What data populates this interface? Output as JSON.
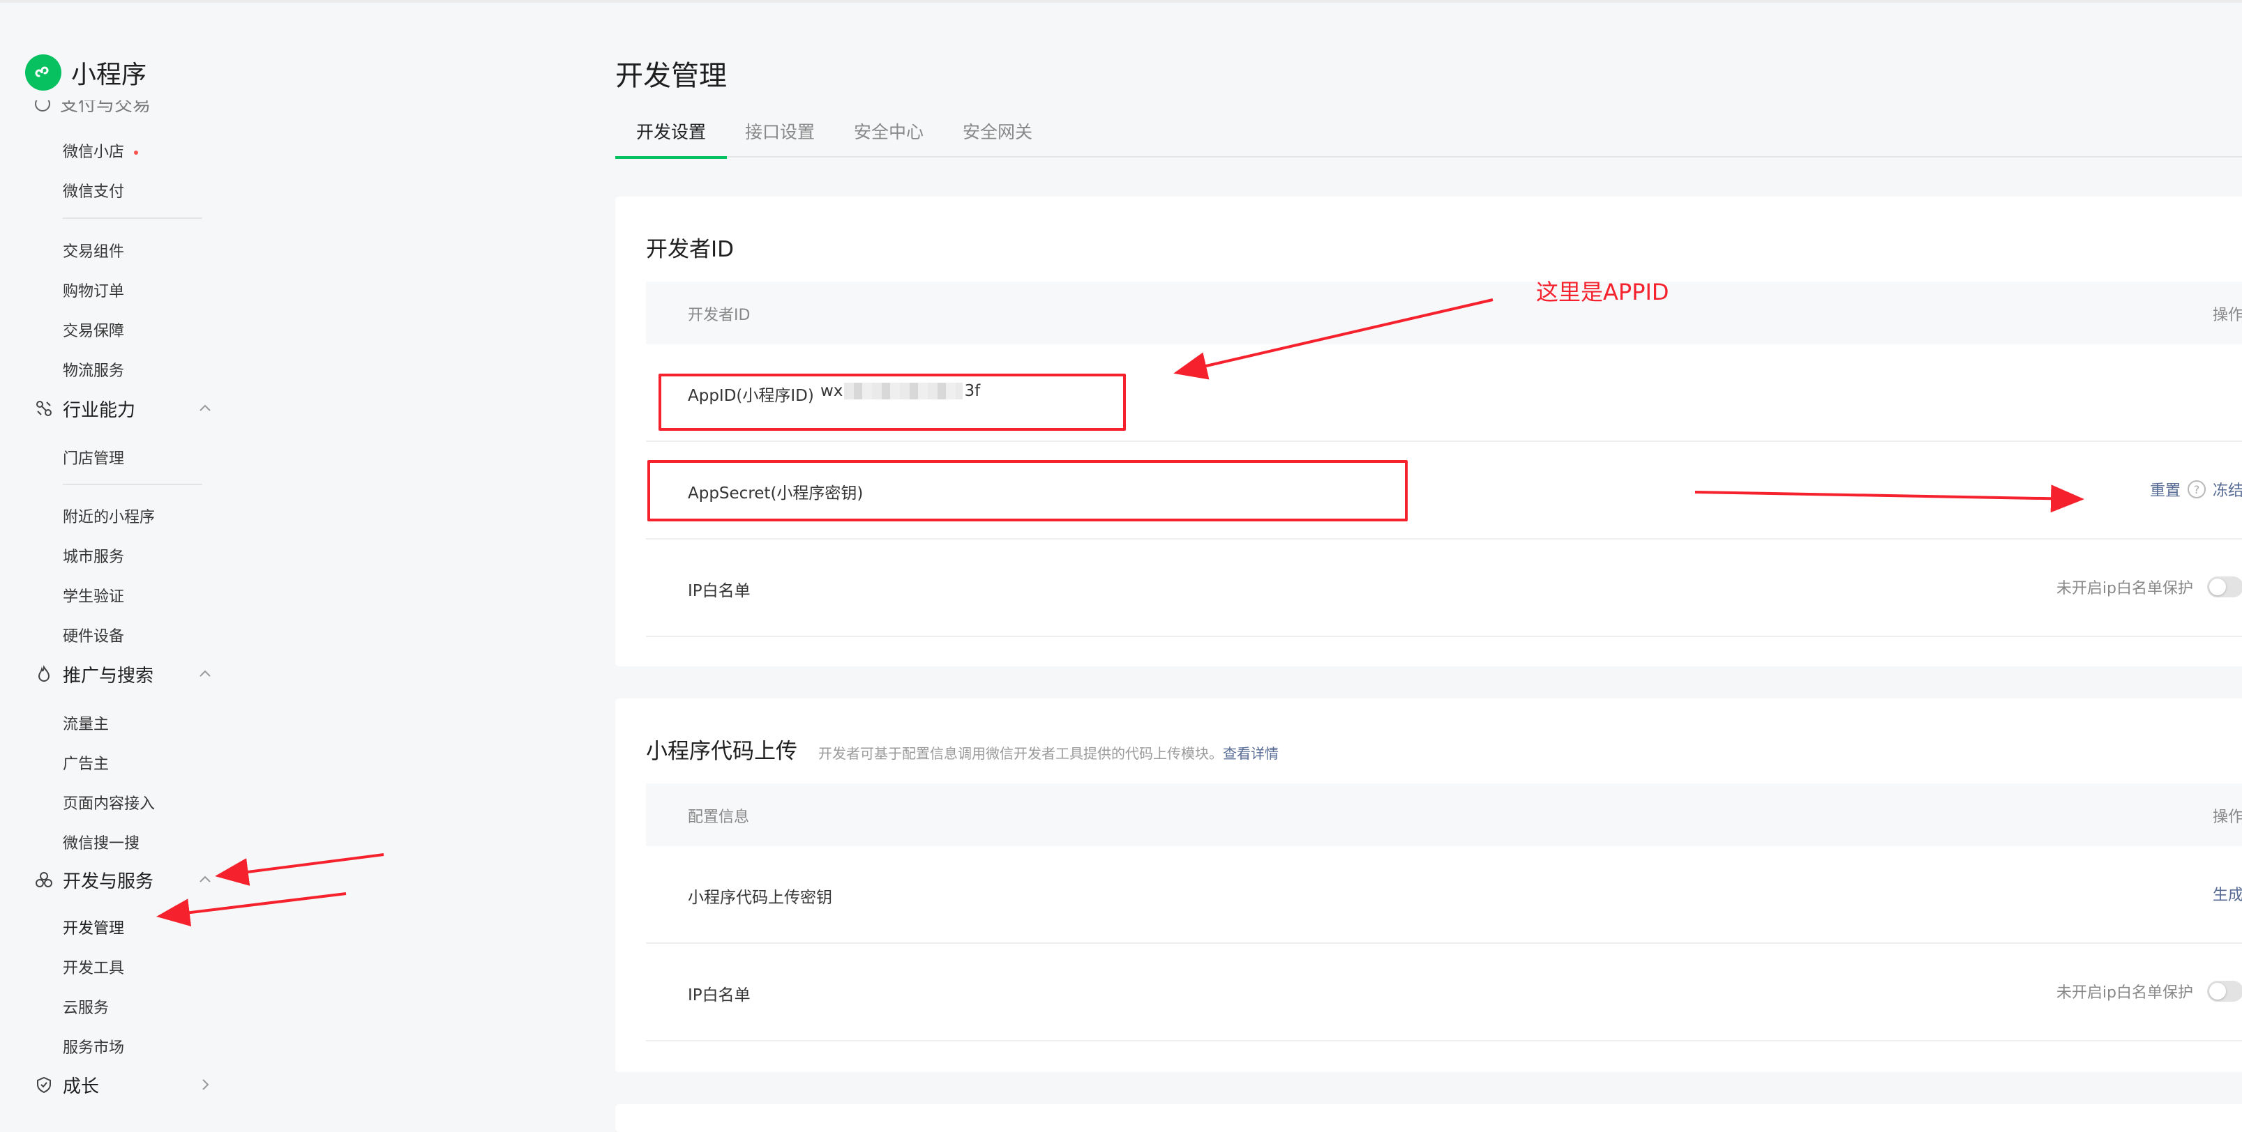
{
  "app": {
    "name": "小程序"
  },
  "sidebar": {
    "truncated_section": "支付与交易",
    "items": [
      {
        "label": "微信小店",
        "dot": true
      },
      {
        "label": "微信支付"
      },
      {
        "label": "交易组件"
      },
      {
        "label": "购物订单"
      },
      {
        "label": "交易保障"
      },
      {
        "label": "物流服务"
      },
      {
        "label": "门店管理"
      },
      {
        "label": "附近的小程序"
      },
      {
        "label": "城市服务"
      },
      {
        "label": "学生验证"
      },
      {
        "label": "硬件设备"
      },
      {
        "label": "流量主"
      },
      {
        "label": "广告主"
      },
      {
        "label": "页面内容接入"
      },
      {
        "label": "微信搜一搜"
      },
      {
        "label": "开发管理"
      },
      {
        "label": "开发工具"
      },
      {
        "label": "云服务"
      },
      {
        "label": "服务市场"
      }
    ],
    "sections": [
      {
        "label": "行业能力",
        "icon": "industry-icon",
        "state": "expanded"
      },
      {
        "label": "推广与搜索",
        "icon": "promote-icon",
        "state": "expanded"
      },
      {
        "label": "开发与服务",
        "icon": "dev-service-icon",
        "state": "expanded"
      },
      {
        "label": "成长",
        "icon": "growth-icon",
        "state": "collapsed"
      }
    ]
  },
  "main": {
    "title": "开发管理",
    "tabs": [
      {
        "label": "开发设置",
        "active": true
      },
      {
        "label": "接口设置"
      },
      {
        "label": "安全中心"
      },
      {
        "label": "安全网关"
      }
    ],
    "developer_id_card": {
      "title": "开发者ID",
      "header_left": "开发者ID",
      "header_right": "操作",
      "appid": {
        "label": "AppID(小程序ID)",
        "value_prefix": "wx",
        "value_suffix": "3f"
      },
      "appsecret": {
        "label": "AppSecret(小程序密钥)",
        "reset": "重置",
        "help": "?",
        "freeze": "冻结"
      },
      "ip_whitelist": {
        "label": "IP白名单",
        "status": "未开启ip白名单保护",
        "enabled": false
      }
    },
    "upload_card": {
      "title": "小程序代码上传",
      "desc": "开发者可基于配置信息调用微信开发者工具提供的代码上传模块。",
      "desc_link": "查看详情",
      "header_left": "配置信息",
      "header_right": "操作",
      "upload_key": {
        "label": "小程序代码上传密钥",
        "action": "生成"
      },
      "ip_whitelist": {
        "label": "IP白名单",
        "status": "未开启ip白名单保护",
        "enabled": false
      }
    }
  },
  "annotations": {
    "appid_note": "这里是APPID"
  },
  "colors": {
    "brand_green": "#07c160",
    "link_blue": "#576b95",
    "annotation_red": "#f5222d"
  }
}
